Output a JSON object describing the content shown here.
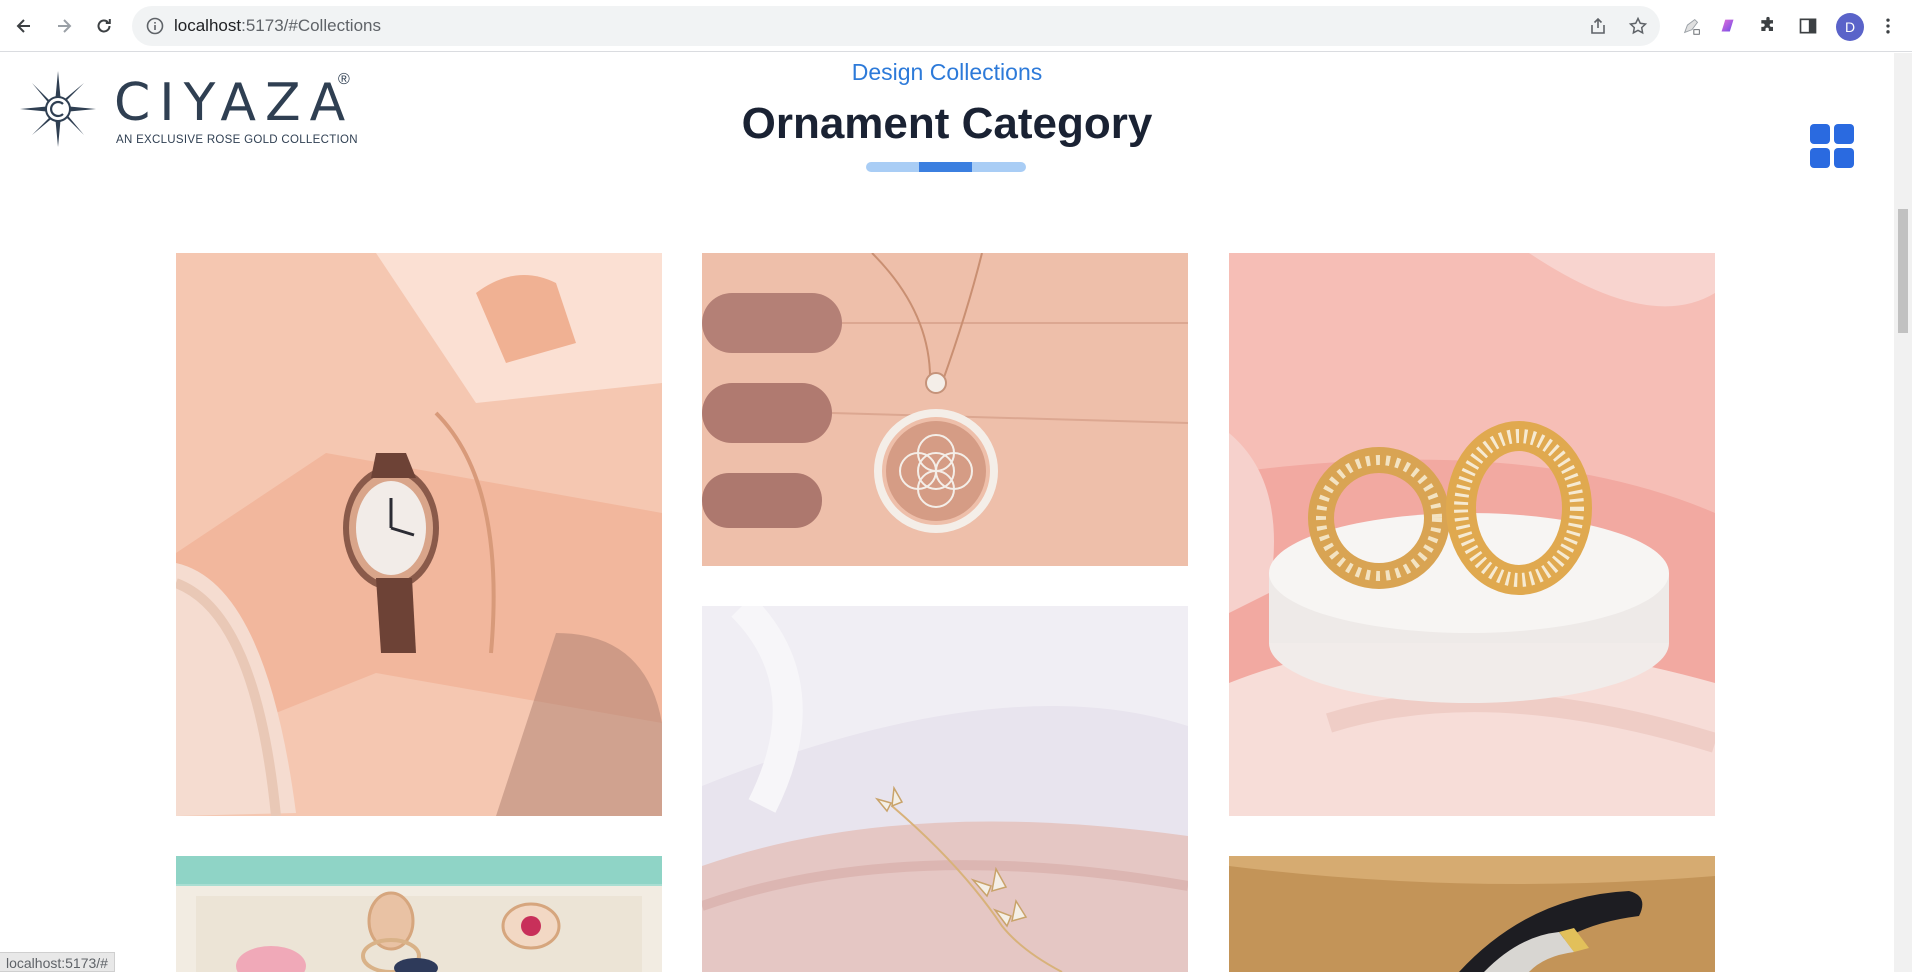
{
  "browser": {
    "url_host": "localhost",
    "url_rest": ":5173/#Collections",
    "profile_initial": "D",
    "status_url": "localhost:5173/#"
  },
  "site": {
    "logo_name": "CIYAZA",
    "logo_reg": "®",
    "logo_tagline": "AN EXCLUSIVE ROSE GOLD COLLECTION"
  },
  "section": {
    "eyebrow": "Design Collections",
    "title": "Ornament Category"
  },
  "colors": {
    "accent": "#2d7ad9",
    "title": "#1a2233",
    "grid_icon": "#2a6ae0",
    "logo": "#2f3f52"
  },
  "gallery": [
    {
      "subject": "rose gold watch and bangle on wrist"
    },
    {
      "subject": "rose gold flower pendant necklace"
    },
    {
      "subject": "pave huggie hoop earrings"
    },
    {
      "subject": "rings in jewelry box"
    },
    {
      "subject": "butterfly chain bracelet"
    },
    {
      "subject": "black band bracelet with pave detail"
    }
  ]
}
